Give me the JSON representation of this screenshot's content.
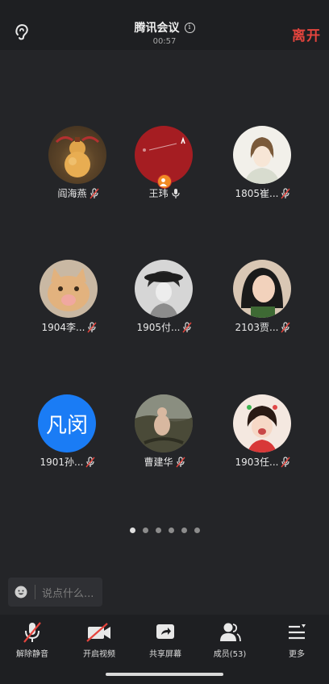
{
  "header": {
    "title": "腾讯会议",
    "timer": "00:57",
    "leave_label": "离开",
    "leave_color": "#e5443d"
  },
  "participants": [
    {
      "name": "阎海燕",
      "mic": "muted",
      "avatar_icon": "gourd-photo"
    },
    {
      "name": "王玮",
      "mic": "on",
      "avatar_icon": "red-artwork",
      "host": true
    },
    {
      "name": "1805崔...",
      "mic": "muted",
      "avatar_icon": "anime-boy"
    },
    {
      "name": "1904李...",
      "mic": "muted",
      "avatar_icon": "cat-photo"
    },
    {
      "name": "1905付...",
      "mic": "muted",
      "avatar_icon": "girl-sketch"
    },
    {
      "name": "2103贾...",
      "mic": "muted",
      "avatar_icon": "girl-photo"
    },
    {
      "name": "1901孙...",
      "mic": "muted",
      "avatar_text": "凡闵",
      "avatar_color": "#1a7cf5"
    },
    {
      "name": "曹建华",
      "mic": "muted",
      "avatar_icon": "landscape-photo"
    },
    {
      "name": "1903任...",
      "mic": "muted",
      "avatar_icon": "child-photo"
    }
  ],
  "pagination": {
    "pages": 6,
    "current": 1
  },
  "chat": {
    "placeholder": "说点什么..."
  },
  "toolbar": {
    "unmute": "解除静音",
    "start_video": "开启视频",
    "share_screen": "共享屏幕",
    "members": "成员(53)",
    "more": "更多"
  }
}
